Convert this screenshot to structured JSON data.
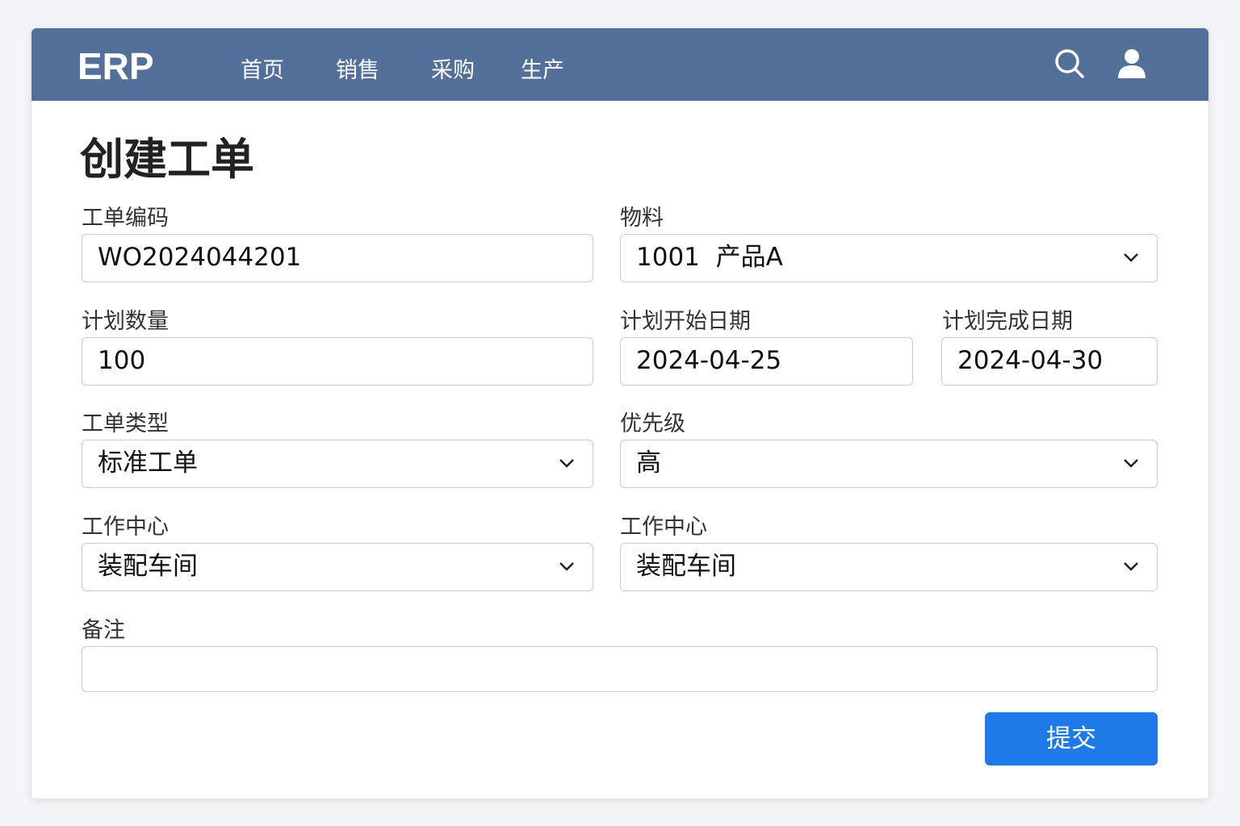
{
  "nav": {
    "logo": "ERP",
    "items": [
      "首页",
      "销售",
      "采购",
      "生产"
    ]
  },
  "page_title": "创建工单",
  "form": {
    "order_no": {
      "label": "工单编码",
      "value": "WO2024044201"
    },
    "material": {
      "label": "物料",
      "value": "1001  产品A"
    },
    "quantity": {
      "label": "计划数量",
      "value": "100"
    },
    "start_date": {
      "label": "计划开始日期",
      "value": "2024-04-25"
    },
    "end_date": {
      "label": "计划完成日期",
      "value": "2024-04-30"
    },
    "order_type": {
      "label": "工单类型",
      "value": "标准工单"
    },
    "priority": {
      "label": "优先级",
      "value": "高"
    },
    "work_center_1": {
      "label": "工作中心",
      "value": "装配车间"
    },
    "work_center_2": {
      "label": "工作中心",
      "value": "装配车间"
    },
    "remarks": {
      "label": "备注",
      "value": ""
    }
  },
  "submit_label": "提交"
}
